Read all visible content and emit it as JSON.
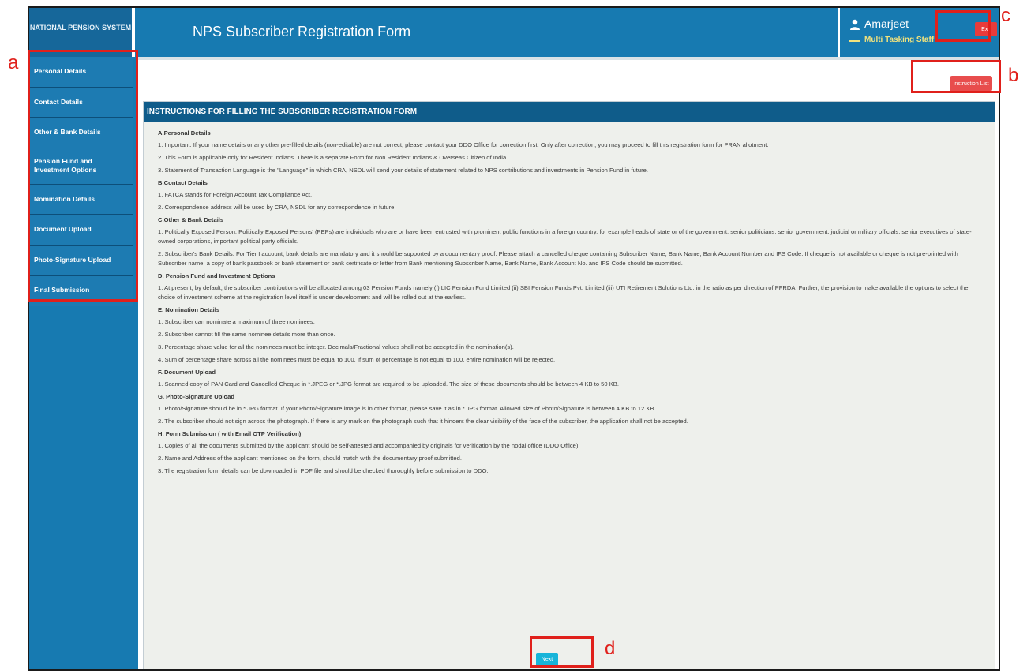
{
  "header": {
    "logo_text": "NATIONAL PENSION SYSTEM",
    "title": "NPS Subscriber Registration Form",
    "user_name": "Amarjeet",
    "user_role": "Multi Tasking Staff",
    "exit_label": "Exit"
  },
  "sidebar": {
    "items": [
      {
        "label": "Personal Details"
      },
      {
        "label": "Contact Details"
      },
      {
        "label": "Other & Bank Details"
      },
      {
        "label": "Pension Fund and Investment Options"
      },
      {
        "label": "Nomination Details"
      },
      {
        "label": "Document Upload"
      },
      {
        "label": "Photo-Signature Upload"
      },
      {
        "label": "Final Submission"
      }
    ]
  },
  "toolbar": {
    "instruction_label": "Instruction List"
  },
  "instructions": {
    "heading": "INSTRUCTIONS FOR FILLING THE SUBSCRIBER REGISTRATION FORM",
    "sections": [
      {
        "title": "A.Personal Details",
        "items": [
          "1. Important: If your name details or any other pre-filled details (non-editable) are not correct, please contact your DDO Office for correction first. Only after correction, you may proceed to fill this registration form for PRAN allotment.",
          "2. This Form is applicable only for Resident Indians. There is a separate Form for Non Resident Indians & Overseas Citizen of India.",
          "3. Statement of Transaction Language is the \"Language\" in which CRA, NSDL will send your details of statement related to NPS contributions and investments in Pension Fund in future."
        ]
      },
      {
        "title": "B.Contact Details",
        "items": [
          "1. FATCA stands for Foreign Account Tax Compliance Act.",
          "2. Correspondence address will be used by CRA, NSDL for any correspondence in future."
        ]
      },
      {
        "title": "C.Other & Bank Details",
        "items": [
          "1. Politically Exposed Person: Politically Exposed Persons' (PEPs) are individuals who are or have been entrusted with prominent public functions in a foreign country, for example heads of state or of the government, senior politicians, senior government, judicial or military officials, senior executives of state-owned corporations, important political party officials.",
          "2. Subscriber's Bank Details: For Tier I account, bank details are mandatory and it should be supported by a documentary proof. Please attach a cancelled cheque containing Subscriber Name, Bank Name, Bank Account Number and IFS Code. If cheque is not available or cheque is not pre-printed with Subscriber name, a copy of bank passbook or bank statement or bank certificate or letter from Bank mentioning Subscriber Name, Bank Name, Bank Account No. and IFS Code should be submitted."
        ]
      },
      {
        "title": "D. Pension Fund and Investment Options",
        "items": [
          "1. At present, by default, the subscriber contributions will be allocated among 03 Pension Funds namely (i) LIC Pension Fund Limited (ii) SBI Pension Funds Pvt. Limited (iii) UTI Retirement Solutions Ltd. in the ratio as per direction of PFRDA. Further, the provision to make available the options to select the choice of investment scheme at the registration level itself is under development and will be rolled out at the earliest."
        ]
      },
      {
        "title": "E. Nomination Details",
        "items": [
          "1. Subscriber can nominate a maximum of three nominees.",
          "2. Subscriber cannot fill the same nominee details more than once.",
          "3. Percentage share value for all the nominees must be integer. Decimals/Fractional values shall not be accepted in the nomination(s).",
          "4. Sum of percentage share across all the nominees must be equal to 100. If sum of percentage is not equal to 100, entire nomination will be rejected."
        ]
      },
      {
        "title": "F. Document Upload",
        "items": [
          "1. Scanned copy of PAN Card and Cancelled Cheque in *.JPEG or *.JPG format are required to be uploaded. The size of these documents should be between 4 KB to 50 KB."
        ]
      },
      {
        "title": "G. Photo-Signature Upload",
        "items": [
          "1. Photo/Signature should be in *.JPG format. If your Photo/Signature image is in other format, please save it as in *.JPG format. Allowed size of Photo/Signature is between 4 KB to 12 KB.",
          "2. The subscriber should not sign across the photograph. If there is any mark on the photograph such that it hinders the clear visibility of the face of the subscriber, the application shall not be accepted."
        ]
      },
      {
        "title": "H. Form Submission ( with Email OTP Verification)",
        "items": [
          "1. Copies of all the documents submitted by the applicant should be self-attested and accompanied by originals for verification by the nodal office (DDO Office).",
          "2. Name and Address of the applicant mentioned on the form, should match with the documentary proof submitted.",
          "3. The registration form details can be downloaded in PDF file and should be checked thoroughly before submission to DDO."
        ]
      }
    ],
    "next_label": "Next"
  },
  "annotations": {
    "a": "a",
    "b": "b",
    "c": "c",
    "d": "d"
  },
  "colors": {
    "header_blue": "#177ab1",
    "panel_head": "#0f5c8a",
    "annotation_red": "#e0201b",
    "exit_red": "#e83b3b",
    "next_cyan": "#17b4d9"
  }
}
